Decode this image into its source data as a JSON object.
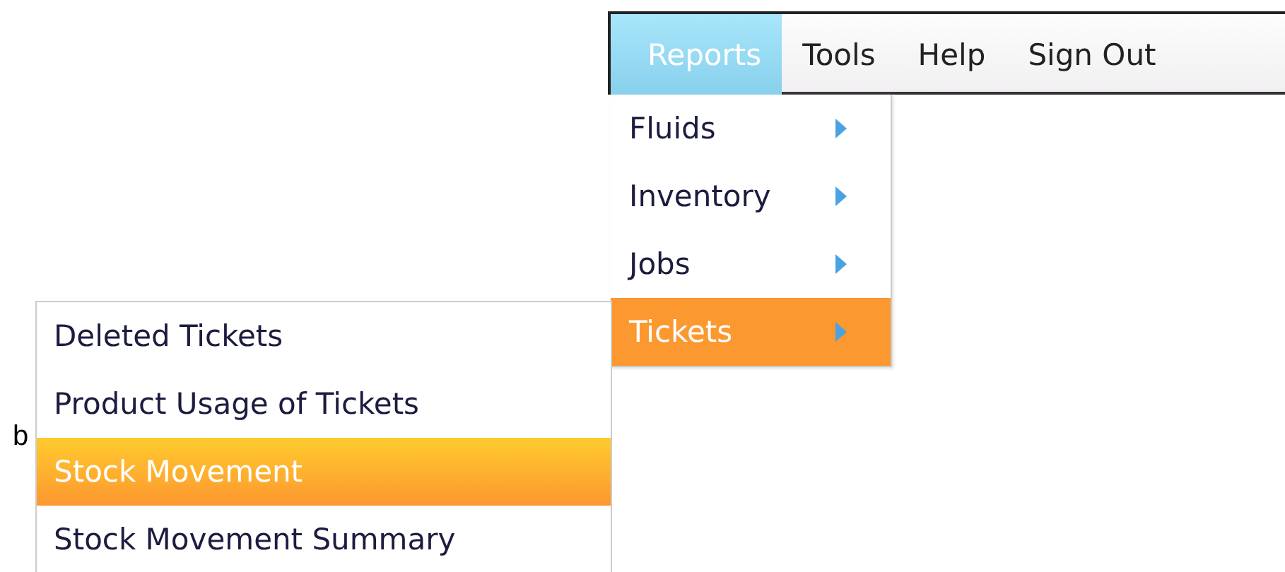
{
  "menu_bar": {
    "items": [
      {
        "label": "Reports",
        "selected": true
      },
      {
        "label": "Tools",
        "selected": false
      },
      {
        "label": "Help",
        "selected": false
      },
      {
        "label": "Sign Out",
        "selected": false
      }
    ]
  },
  "reports_menu": {
    "items": [
      {
        "label": "Fluids",
        "selected": false,
        "has_submenu": true
      },
      {
        "label": "Inventory",
        "selected": false,
        "has_submenu": true
      },
      {
        "label": "Jobs",
        "selected": false,
        "has_submenu": true
      },
      {
        "label": "Tickets",
        "selected": true,
        "has_submenu": true
      }
    ]
  },
  "tickets_submenu": {
    "items": [
      {
        "label": "Deleted Tickets",
        "selected": false
      },
      {
        "label": "Product Usage of Tickets",
        "selected": false
      },
      {
        "label": "Stock Movement",
        "selected": true
      },
      {
        "label": "Stock Movement Summary",
        "selected": false
      }
    ]
  },
  "background_text": "b"
}
